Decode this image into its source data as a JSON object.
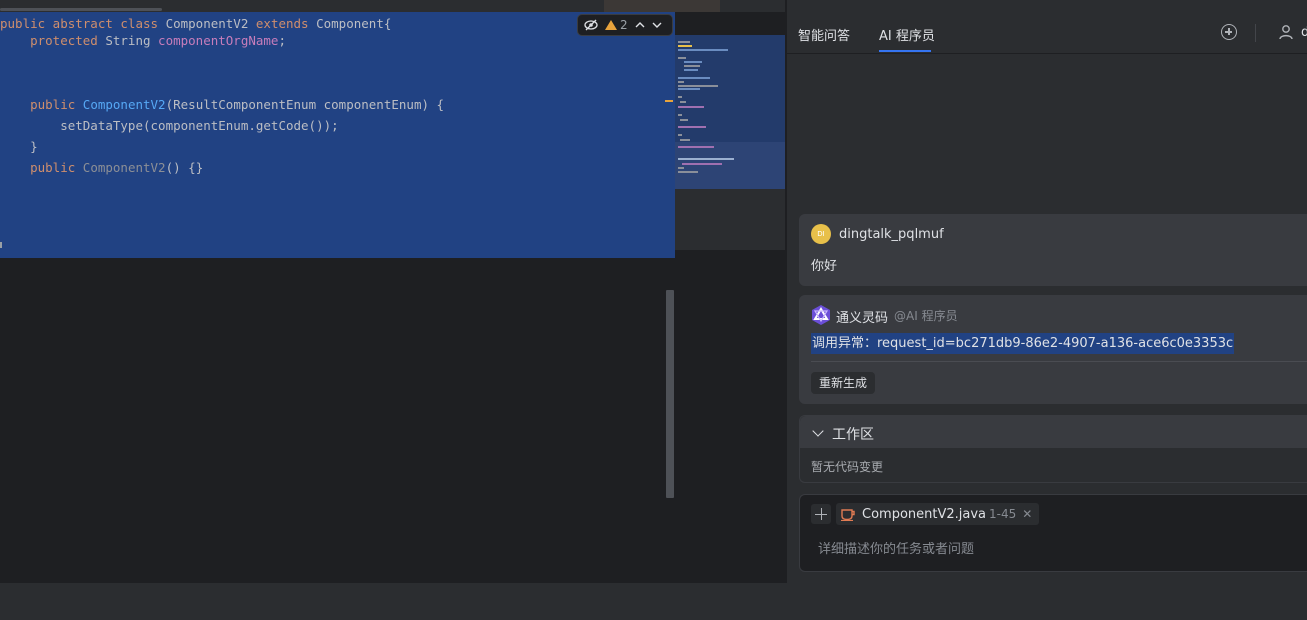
{
  "editor": {
    "code_lines": [
      {
        "parts": [
          [
            "kw",
            "public abstract class "
          ],
          [
            "pl",
            "ComponentV2 "
          ],
          [
            "kw",
            "extends "
          ],
          [
            "pl",
            "Component{"
          ]
        ]
      },
      {
        "parts": [
          [
            "kw",
            "    protected "
          ],
          [
            "pl",
            "String "
          ],
          [
            "fld",
            "componentOrgName"
          ],
          [
            "pl",
            ";"
          ]
        ]
      },
      {
        "parts": []
      },
      {
        "parts": []
      },
      {
        "parts": [
          [
            "kw",
            "    public "
          ],
          [
            "fn",
            "ComponentV2"
          ],
          [
            "pl",
            "(ResultComponentEnum componentEnum) {"
          ]
        ]
      },
      {
        "parts": [
          [
            "pl",
            "        setDataType(componentEnum.getCode());"
          ]
        ]
      },
      {
        "parts": [
          [
            "pl",
            "    }"
          ]
        ]
      },
      {
        "parts": [
          [
            "kw",
            "    public "
          ],
          [
            "dim",
            "ComponentV2"
          ],
          [
            "pl",
            "() {}"
          ]
        ]
      }
    ],
    "inspection": {
      "eye_icon": "eye-off-icon",
      "warning_count": "2"
    }
  },
  "panel": {
    "tabs": [
      {
        "label": "智能问答",
        "active": false
      },
      {
        "label": "AI 程序员",
        "active": true
      }
    ],
    "header_user_initial": "d",
    "user_message": {
      "avatar_text": "DI",
      "name": "dingtalk_pqlmuf",
      "text": "你好"
    },
    "ai_message": {
      "name": "通义灵码",
      "mention": "@AI 程序员",
      "error": "调用异常：request_id=bc271db9-86e2-4907-a136-ace6c0e3353c",
      "regenerate_label": "重新生成"
    },
    "workspace": {
      "title": "工作区",
      "empty_text": "暂无代码变更"
    },
    "input": {
      "file_name": "ComponentV2.java",
      "file_range": "1-45",
      "placeholder": "详细描述你的任务或者问题"
    }
  },
  "colors": {
    "selection": "#214283",
    "accent": "#3574f0",
    "warning": "#e8a33c",
    "keyword": "#cf8e6d",
    "function": "#56a8f5"
  }
}
